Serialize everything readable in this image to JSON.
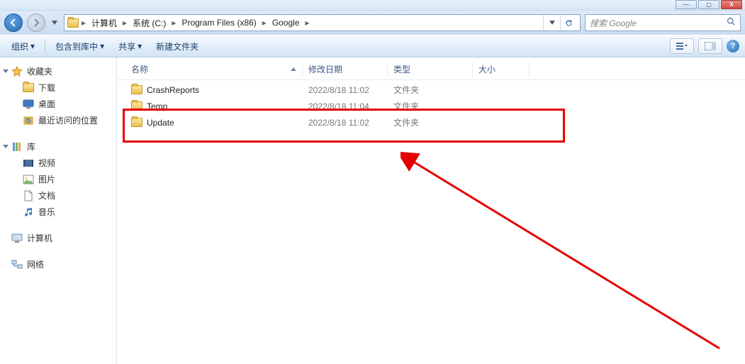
{
  "titlebar": {
    "min": "—",
    "max": "▢",
    "close": "X"
  },
  "nav": {
    "crumbs": [
      "计算机",
      "系统 (C:)",
      "Program Files (x86)",
      "Google"
    ]
  },
  "search": {
    "placeholder": "搜索 Google"
  },
  "toolbar": {
    "organize": "组织",
    "include": "包含到库中",
    "share": "共享",
    "newfolder": "新建文件夹"
  },
  "sidebar": {
    "favorites": {
      "label": "收藏夹",
      "items": [
        "下载",
        "桌面",
        "最近访问的位置"
      ]
    },
    "libraries": {
      "label": "库",
      "items": [
        "视频",
        "图片",
        "文档",
        "音乐"
      ]
    },
    "computer": {
      "label": "计算机"
    },
    "network": {
      "label": "网络"
    }
  },
  "columns": {
    "name": "名称",
    "date": "修改日期",
    "type": "类型",
    "size": "大小"
  },
  "rows": [
    {
      "name": "CrashReports",
      "date": "2022/8/18 11:02",
      "type": "文件夹",
      "size": ""
    },
    {
      "name": "Temp",
      "date": "2022/8/18 11:04",
      "type": "文件夹",
      "size": ""
    },
    {
      "name": "Update",
      "date": "2022/8/18 11:02",
      "type": "文件夹",
      "size": ""
    }
  ]
}
